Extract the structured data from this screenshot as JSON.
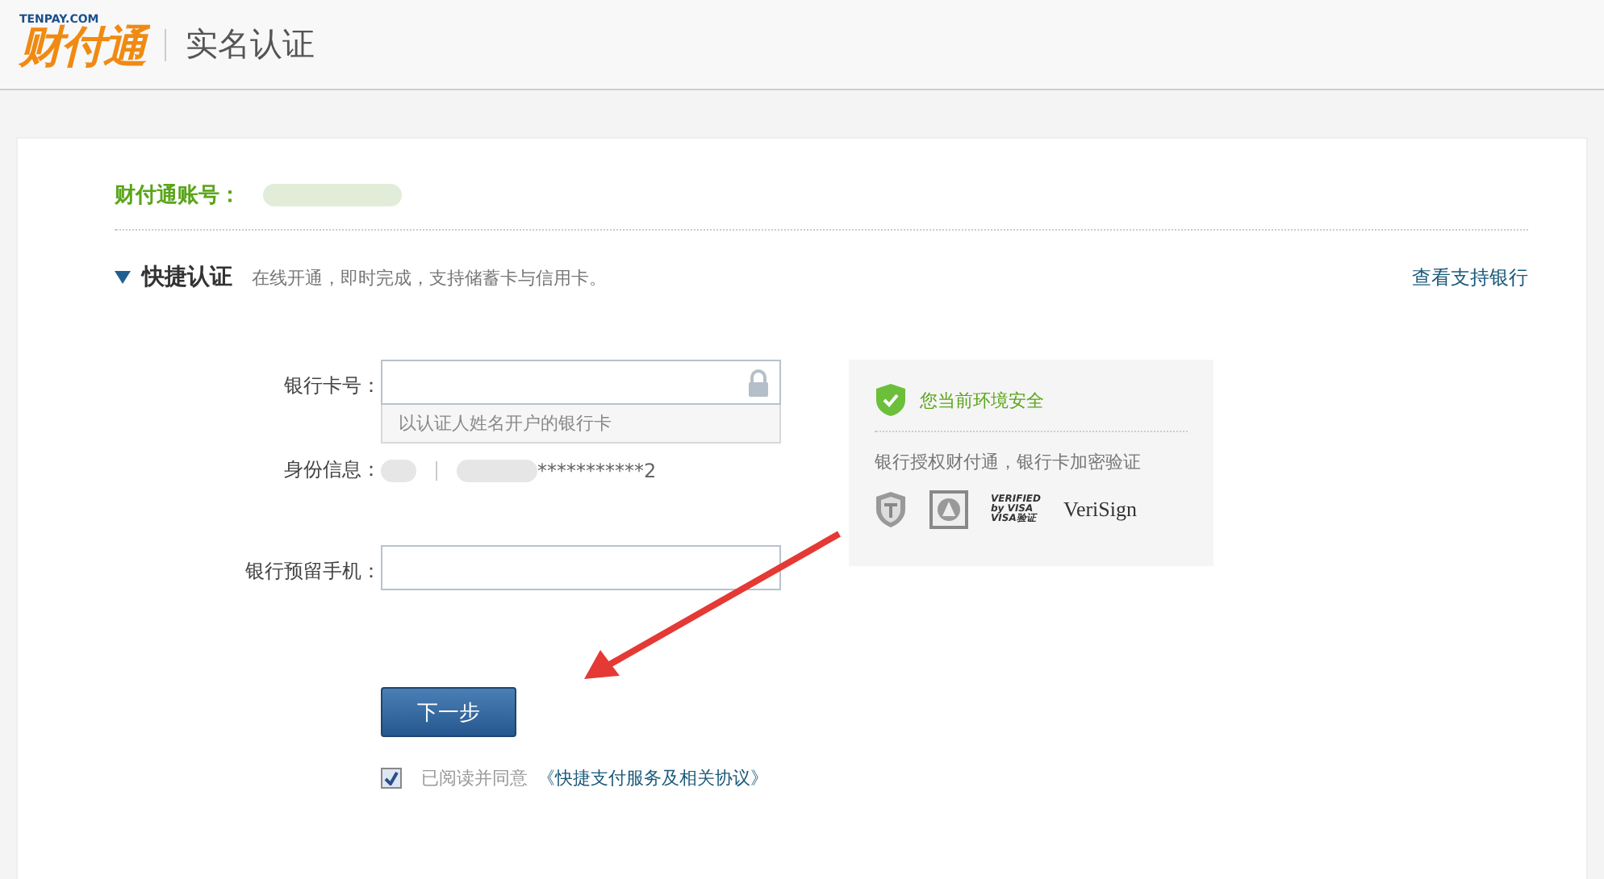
{
  "header": {
    "logo_small": "TENPAY.COM",
    "logo": "财付通",
    "title": "实名认证"
  },
  "account": {
    "label": "财付通账号："
  },
  "section": {
    "expanded": true,
    "title": "快捷认证",
    "description": "在线开通，即时完成，支持储蓄卡与信用卡。",
    "link": "查看支持银行"
  },
  "form": {
    "card_label": "银行卡号：",
    "card_hint": "以认证人姓名开户的银行卡",
    "id_label": "身份信息：",
    "id_value": "***********2",
    "phone_label": "银行预留手机："
  },
  "security": {
    "title": "您当前环境安全",
    "description": "银行授权财付通，银行卡加密验证",
    "badges": [
      {
        "kind": "shield"
      },
      {
        "kind": "seal"
      },
      {
        "kind": "visa",
        "line1": "VERIFIED",
        "line2": "by VISA",
        "line3": "VISA验证"
      },
      {
        "kind": "verisign",
        "text": "VeriSign"
      }
    ]
  },
  "submit": "下一步",
  "agreement": {
    "checked": true,
    "text": "已阅读并同意",
    "link": "《快捷支付服务及相关协议》"
  }
}
